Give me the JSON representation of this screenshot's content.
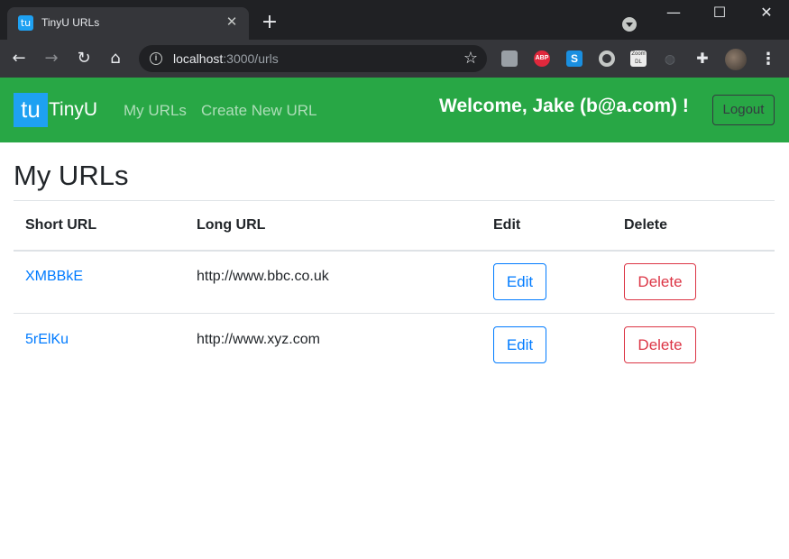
{
  "browser": {
    "tab_title": "TinyU URLs",
    "tab_favicon": "tu",
    "tab_close": "✕",
    "new_tab": "+",
    "window_controls": {
      "minimize": "—",
      "maximize": "☐",
      "close": "✕"
    },
    "url_host": "localhost",
    "url_path": ":3000/urls",
    "extension_icons": [
      "profile-icon",
      "abp-icon",
      "s-icon",
      "circle-icon",
      "zoom-dl-icon",
      "leaf-icon",
      "puzzle-icon"
    ],
    "abp_label": "ABP",
    "s_label": "S",
    "zoom_label_top": "Zoom",
    "zoom_label_bottom": "DL"
  },
  "navbar": {
    "brand_logo": "tu",
    "brand_name": "TinyU",
    "links": [
      "My URLs",
      "Create New URL"
    ],
    "welcome": "Welcome, Jake (b@a.com) !",
    "logout_label": "Logout",
    "background_color": "#28a745"
  },
  "main": {
    "title": "My URLs",
    "table": {
      "headers": [
        "Short URL",
        "Long URL",
        "Edit",
        "Delete"
      ],
      "rows": [
        {
          "short_url": "XMBBkE",
          "long_url": "http://www.bbc.co.uk",
          "edit_label": "Edit",
          "delete_label": "Delete"
        },
        {
          "short_url": "5rElKu",
          "long_url": "http://www.xyz.com",
          "edit_label": "Edit",
          "delete_label": "Delete"
        }
      ]
    }
  },
  "colors": {
    "link": "#007bff",
    "danger": "#dc3545",
    "brand_logo_bg": "#1ea1f2"
  }
}
